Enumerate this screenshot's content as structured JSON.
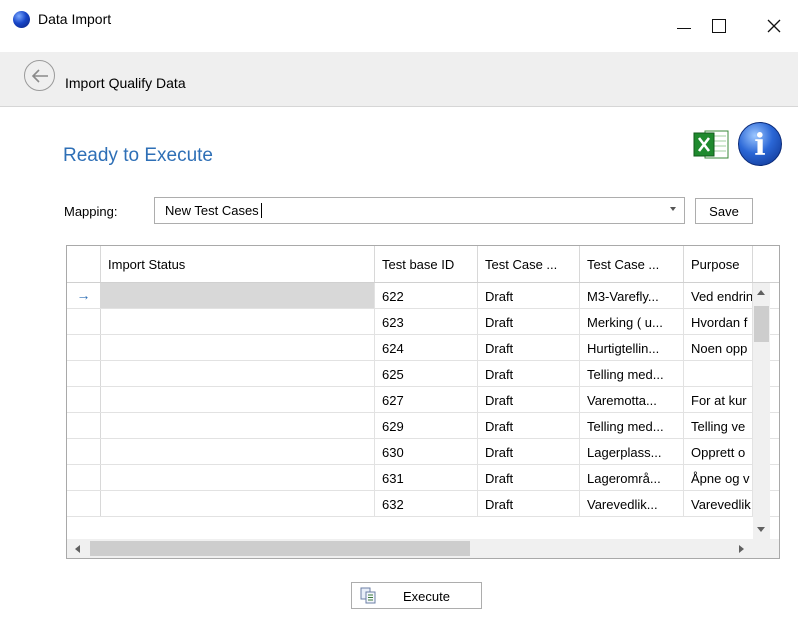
{
  "window": {
    "title": "Data Import"
  },
  "header": {
    "title": "Import Qualify Data"
  },
  "main": {
    "section_title": "Ready to Execute",
    "mapping_label": "Mapping:",
    "mapping_value": "New Test Cases",
    "save_label": "Save",
    "execute_label": "Execute"
  },
  "grid": {
    "columns": [
      "Import Status",
      "Test base ID",
      "Test Case ...",
      "Test Case ...",
      "Purpose"
    ],
    "selected_row_marker": "→",
    "rows": [
      {
        "status": "",
        "id": "622",
        "state": "Draft",
        "name": "M3-Varefly...",
        "purpose": "Ved endrin"
      },
      {
        "status": "",
        "id": "623",
        "state": "Draft",
        "name": "Merking ( u...",
        "purpose": "Hvordan f"
      },
      {
        "status": "",
        "id": "624",
        "state": "Draft",
        "name": "Hurtigtellin...",
        "purpose": "Noen opp"
      },
      {
        "status": "",
        "id": "625",
        "state": "Draft",
        "name": "Telling med...",
        "purpose": ""
      },
      {
        "status": "",
        "id": "627",
        "state": "Draft",
        "name": "Varemotta...",
        "purpose": "For at kur"
      },
      {
        "status": "",
        "id": "629",
        "state": "Draft",
        "name": "Telling med...",
        "purpose": "Telling ve"
      },
      {
        "status": "",
        "id": "630",
        "state": "Draft",
        "name": "Lagerplass...",
        "purpose": "Opprett o"
      },
      {
        "status": "",
        "id": "631",
        "state": "Draft",
        "name": "Lagerområ...",
        "purpose": "Åpne og v"
      },
      {
        "status": "",
        "id": "632",
        "state": "Draft",
        "name": "Varevedlik...",
        "purpose": "Varevedlik"
      }
    ]
  },
  "colors": {
    "accent": "#2e6fb6",
    "selected_row": "#d8d8d8",
    "header_band": "#efefef"
  },
  "icons": [
    "app-orb-icon",
    "minimize-icon",
    "maximize-icon",
    "close-icon",
    "back-arrow-icon",
    "excel-icon",
    "info-icon",
    "dropdown-arrow-icon",
    "execute-icon"
  ]
}
